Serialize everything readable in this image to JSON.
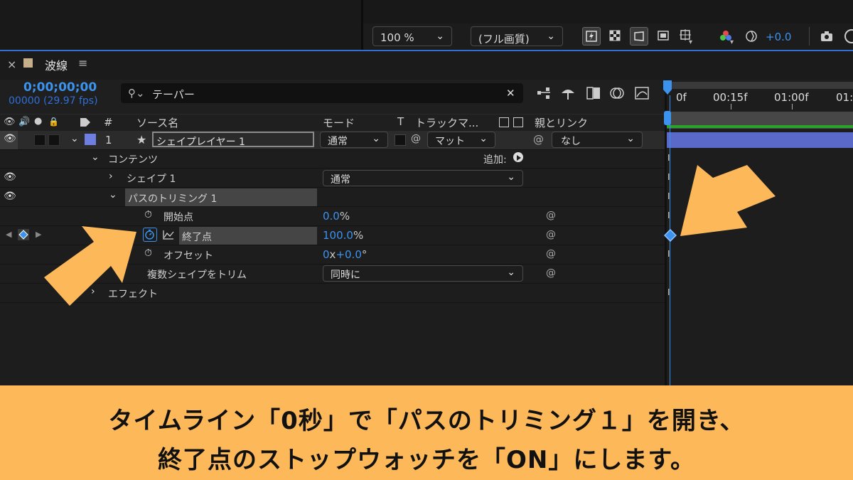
{
  "viewer_toolbar": {
    "zoom": "100 %",
    "resolution": "(フル画質)",
    "exposure": "+0.0"
  },
  "panel": {
    "close": "×",
    "title": "波線",
    "menu": "≡"
  },
  "timecode": {
    "time": "0;00;00;00",
    "frames": "00000 (29.97 fps)"
  },
  "search": {
    "value": "テーパー",
    "clear": "✕"
  },
  "columns": {
    "label_hash": "#",
    "source_name": "ソース名",
    "mode": "モード",
    "t": "T",
    "track_matte": "トラックマ...",
    "parent_link": "親とリンク"
  },
  "ruler": {
    "t0": "0f",
    "t1": "00:15f",
    "t2": "01:00f",
    "t3": "01:"
  },
  "layer": {
    "index": "1",
    "name": "シェイプレイヤー 1",
    "mode": "通常",
    "matte": "マット",
    "parent": "なし"
  },
  "rows": {
    "contents": "コンテンツ",
    "add_label": "追加:",
    "shape1": "シェイプ 1",
    "shape1_mode": "通常",
    "trim_paths": "パスのトリミング 1",
    "start": "開始点",
    "start_value": "0.0",
    "start_unit": "%",
    "end": "終了点",
    "end_value": "100.0",
    "end_unit": "%",
    "offset": "オフセット",
    "offset_value_a": "0",
    "offset_x": "x",
    "offset_value_b": "+0.0",
    "offset_deg": "°",
    "trim_multiple": "複数シェイプをトリム",
    "trim_multiple_value": "同時に",
    "effects": "エフェクト"
  },
  "caption": {
    "line1": "タイムライン「0秒」で「パスのトリミング１」を開き、",
    "line2": "終了点のストップウォッチを「ON」にします。"
  },
  "colors": {
    "accent_blue": "#3b93ee",
    "caption_bg": "#fdb85a",
    "arrow": "#fdb85a",
    "layer_label": "#6e7fe0"
  }
}
